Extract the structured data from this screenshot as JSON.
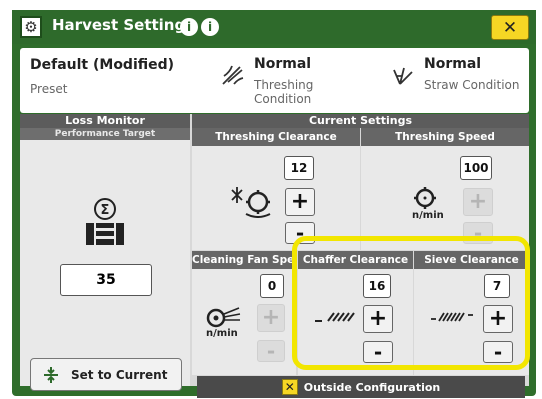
{
  "title": "Harvest Settings",
  "icons": {
    "title": "gear-icon",
    "help": "info-icon",
    "info": "dot-info-icon",
    "close": "close-x-icon"
  },
  "close_label": "✕",
  "preset": {
    "name": "Default (Modified)",
    "label": "Preset"
  },
  "conditions": [
    {
      "value": "Normal",
      "label": "Threshing Condition",
      "icon": "threshing-condition-icon"
    },
    {
      "value": "Normal",
      "label": "Straw Condition",
      "icon": "straw-condition-icon"
    }
  ],
  "loss_monitor": {
    "header": "Loss Monitor",
    "subheader": "Performance Target",
    "value": "35",
    "icon": "loss-monitor-icon",
    "set_button": "Set to Current"
  },
  "current_settings": {
    "header": "Current Settings",
    "threshing_clearance": {
      "label": "Threshing Clearance",
      "value": "12"
    },
    "threshing_speed": {
      "label": "Threshing Speed",
      "value": "100",
      "unit": "n/min"
    },
    "cleaning_fan_speed": {
      "label": "Cleaning Fan Speed",
      "value": "0",
      "unit": "n/min"
    },
    "chaffer_clearance": {
      "label": "Chaffer Clearance",
      "value": "16"
    },
    "sieve_clearance": {
      "label": "Sieve Clearance",
      "value": "7"
    }
  },
  "plus_label": "+",
  "minus_label": "-",
  "outside_configuration": "Outside Configuration",
  "colors": {
    "titlebar": "#2e6a2b",
    "close_button": "#f6d624",
    "highlight": "#f2e600"
  }
}
